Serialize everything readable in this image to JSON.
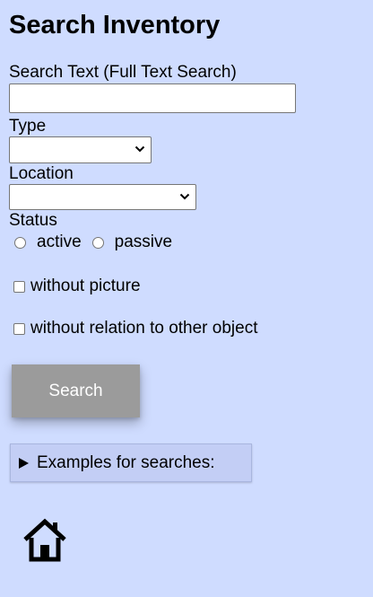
{
  "page": {
    "title": "Search Inventory"
  },
  "form": {
    "search_text_label": "Search Text (Full Text Search)",
    "search_text_value": "",
    "type_label": "Type",
    "type_selected": "",
    "location_label": "Location",
    "location_selected": "",
    "status_label": "Status",
    "status_options": [
      "active",
      "passive"
    ],
    "without_picture_label": "without picture",
    "without_relation_label": "without relation to other object",
    "search_button_label": "Search"
  },
  "examples": {
    "summary_label": "Examples for searches:"
  },
  "icons": {
    "select_chevron": "chevron-down-icon",
    "details_marker": "triangle-right-icon",
    "home": "home-icon"
  },
  "colors": {
    "background": "#cfdcff",
    "button_bg": "#9b9b9b",
    "details_bg": "#c3cef5"
  }
}
